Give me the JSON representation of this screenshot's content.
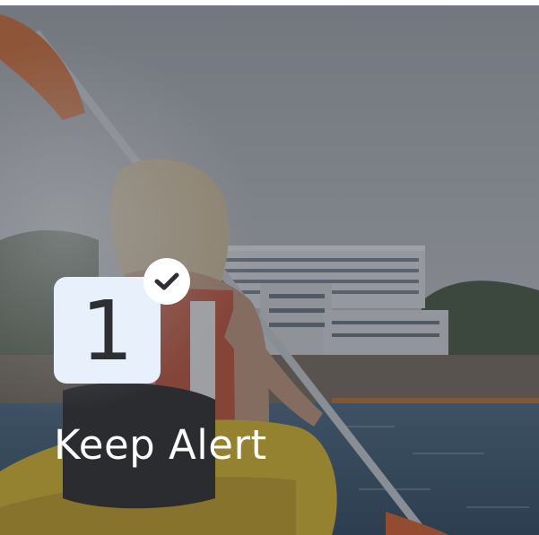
{
  "card": {
    "step_number": "1",
    "title": "Keep Alert",
    "completed": true
  },
  "icons": {
    "status": "checkmark-icon"
  },
  "colors": {
    "badge_background": "#e8f0fb",
    "badge_text": "#2d2f33",
    "check_background": "#ffffff",
    "check_mark": "#2d2f33",
    "title_text": "#ffffff",
    "overlay": "rgba(40,46,56,0.42)"
  }
}
